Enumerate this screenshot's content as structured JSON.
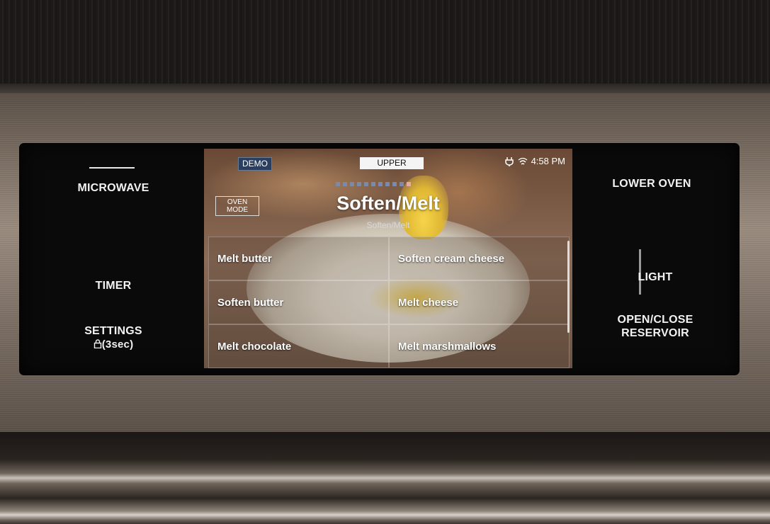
{
  "left_controls": {
    "microwave": "MICROWAVE",
    "timer": "TIMER",
    "settings": "SETTINGS",
    "settings_lock": "⊕(3sec)"
  },
  "right_controls": {
    "lower_oven": "LOWER OVEN",
    "light": "LIGHT",
    "open_close_line1": "OPEN/CLOSE",
    "open_close_line2": "RESERVOIR"
  },
  "screen": {
    "demo_label": "DEMO",
    "cavity_tab": "UPPER",
    "time": "4:58 PM",
    "oven_mode_line1": "OVEN",
    "oven_mode_line2": "MODE",
    "title": "Soften/Melt",
    "subtitle": "Soften/Melt",
    "page_dots_total": 11,
    "page_dots_active_index": 10,
    "options": [
      {
        "label": "Melt butter"
      },
      {
        "label": "Soften cream cheese"
      },
      {
        "label": "Soften butter"
      },
      {
        "label": "Melt cheese"
      },
      {
        "label": "Melt chocolate"
      },
      {
        "label": "Melt marshmallows"
      }
    ]
  },
  "icons": {
    "plug": "plug-icon",
    "wifi": "wifi-icon",
    "lock": "lock-icon"
  }
}
